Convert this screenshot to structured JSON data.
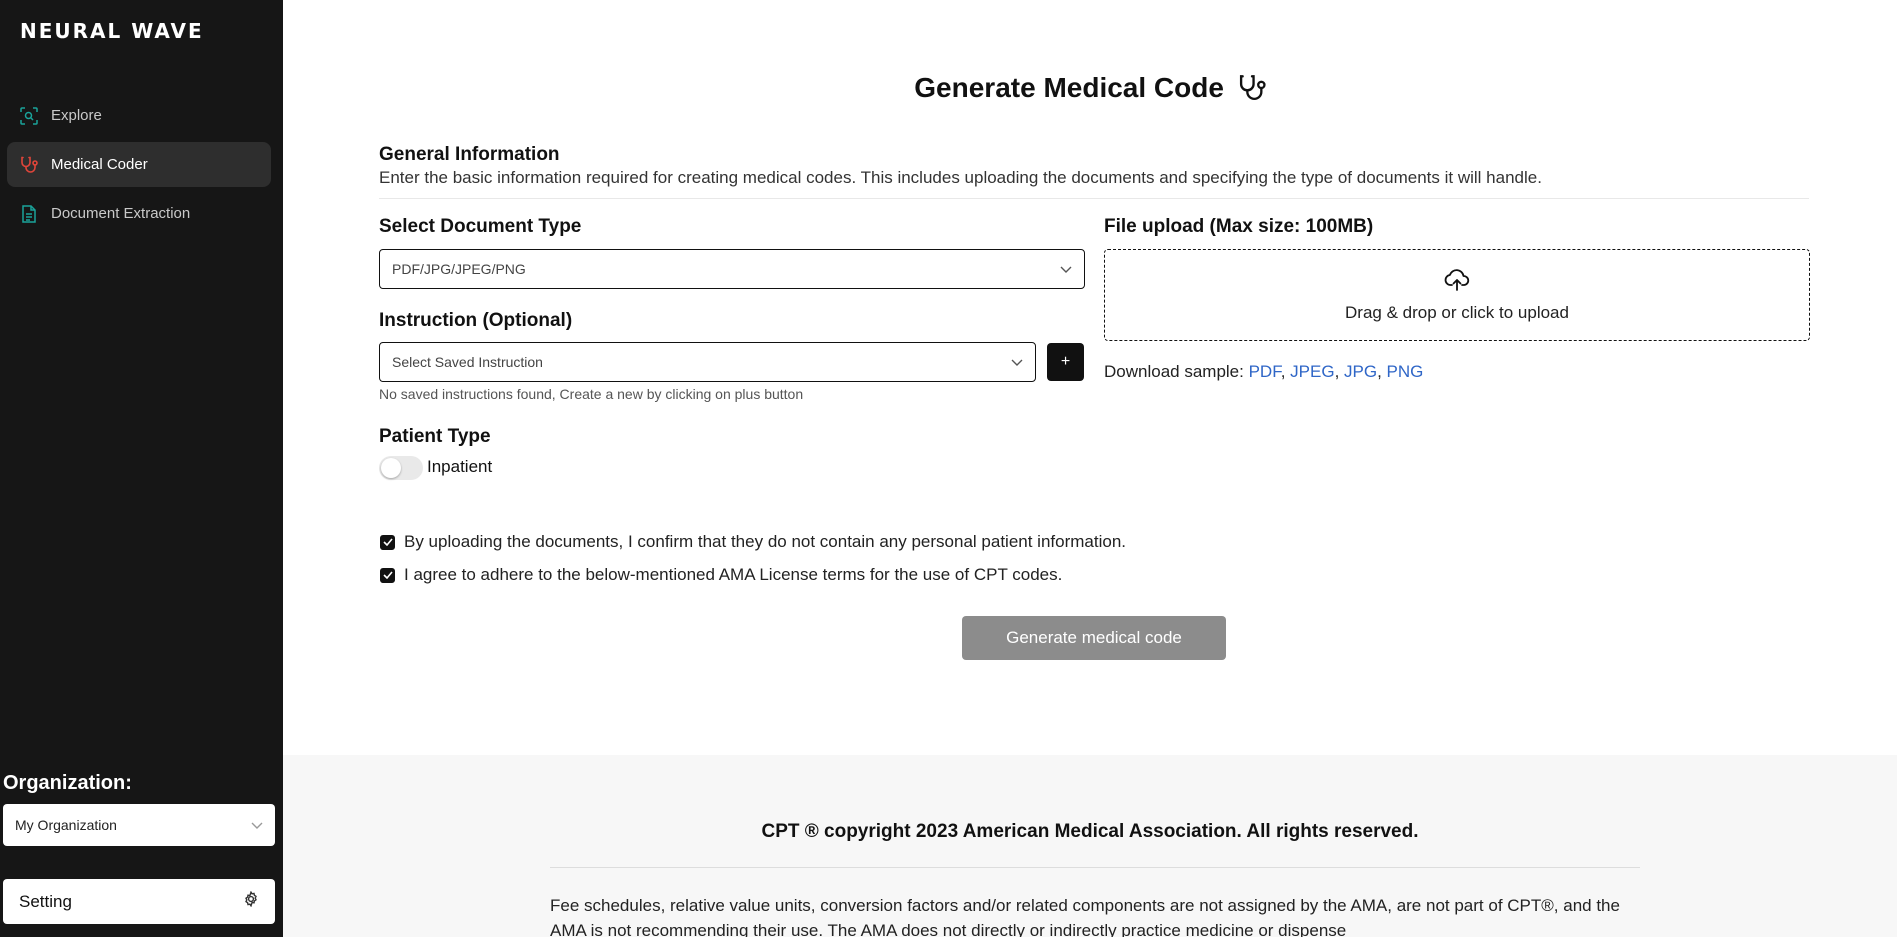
{
  "sidebar": {
    "logo": "NEURAL WAVE",
    "nav": [
      {
        "label": "Explore",
        "icon": "scan-search-icon"
      },
      {
        "label": "Medical Coder",
        "icon": "stethoscope-icon",
        "active": true
      },
      {
        "label": "Document Extraction",
        "icon": "document-icon"
      }
    ],
    "organization_label": "Organization:",
    "organization_value": "My Organization",
    "setting_label": "Setting"
  },
  "main": {
    "title": "Generate Medical Code",
    "general_title": "General Information",
    "general_desc": "Enter the basic information required for creating medical codes. This includes uploading the documents and specifying the type of documents it will handle.",
    "doc_type_label": "Select Document Type",
    "doc_type_value": "PDF/JPG/JPEG/PNG",
    "instruction_label": "Instruction (Optional)",
    "instruction_placeholder": "Select Saved Instruction",
    "instruction_hint": "No saved instructions found, Create a new by clicking on plus button",
    "plus_label": "+",
    "upload_label": "File upload (Max size: 100MB)",
    "upload_text": "Drag & drop or click to upload",
    "download_sample_prefix": "Download sample:",
    "download_links": [
      "PDF",
      "JPEG",
      "JPG",
      "PNG"
    ],
    "patient_type_label": "Patient Type",
    "patient_toggle_label": "Inpatient",
    "checkbox_1": "By uploading the documents, I confirm that they do not contain any personal patient information.",
    "checkbox_2": "I agree to adhere to the below-mentioned AMA License terms for the use of CPT codes.",
    "generate_button": "Generate medical code"
  },
  "footer": {
    "title": "CPT ® copyright 2023 American Medical Association. All rights reserved.",
    "text": "Fee schedules, relative value units, conversion factors and/or related components are not assigned by the AMA, are not part of CPT®, and the AMA is not recommending their use. The AMA does not directly or indirectly practice medicine or dispense"
  },
  "colors": {
    "sidebar_bg": "#161616",
    "accent_teal": "#1aa39a",
    "accent_red": "#e0453a",
    "link_blue": "#2f66c7",
    "button_disabled": "#8c8c8c"
  }
}
